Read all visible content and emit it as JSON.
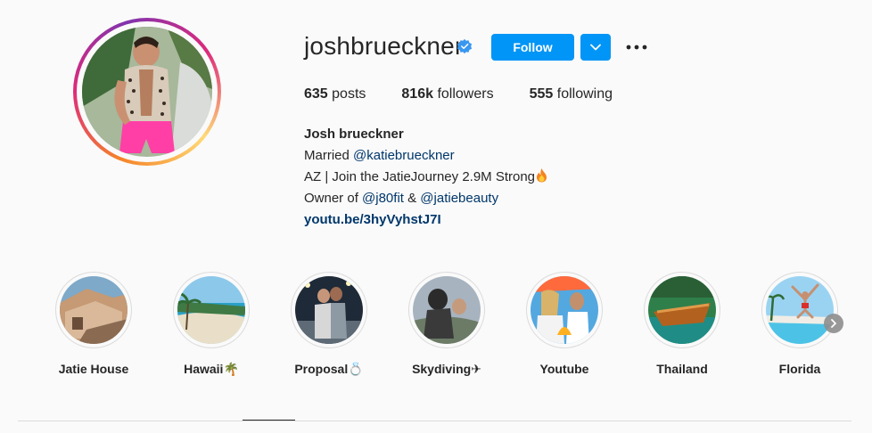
{
  "profile": {
    "username": "joshbrueckner",
    "verified_icon": "verified-badge-icon",
    "follow_label": "Follow",
    "dropdown_icon": "chevron-down-icon",
    "more_icon": "more-options-icon"
  },
  "stats": [
    {
      "count": "635",
      "label": "posts"
    },
    {
      "count": "816k",
      "label": "followers"
    },
    {
      "count": "555",
      "label": "following"
    }
  ],
  "bio": {
    "name": "Josh brueckner",
    "line1_prefix": "Married ",
    "line1_mention": "@katiebrueckner",
    "line2": "AZ | Join the JatieJourney 2.9M Strong",
    "line3_prefix": "Owner of ",
    "line3_mention1": "@j80fit",
    "line3_mid": " & ",
    "line3_mention2": "@jatiebeauty",
    "link": "youtu.be/3hyVyhstJ7I"
  },
  "highlights": [
    {
      "label": "Jatie House",
      "emoji": ""
    },
    {
      "label": "Hawaii",
      "emoji": "🌴"
    },
    {
      "label": "Proposal",
      "emoji": "💍"
    },
    {
      "label": "Skydiving",
      "emoji": "✈"
    },
    {
      "label": "Youtube",
      "emoji": ""
    },
    {
      "label": "Thailand",
      "emoji": ""
    },
    {
      "label": "Florida",
      "emoji": ""
    }
  ],
  "colors": {
    "accent": "#0095f6",
    "link": "#00376b",
    "text": "#262626",
    "border": "#dbdbdb",
    "background": "#fafafa"
  }
}
